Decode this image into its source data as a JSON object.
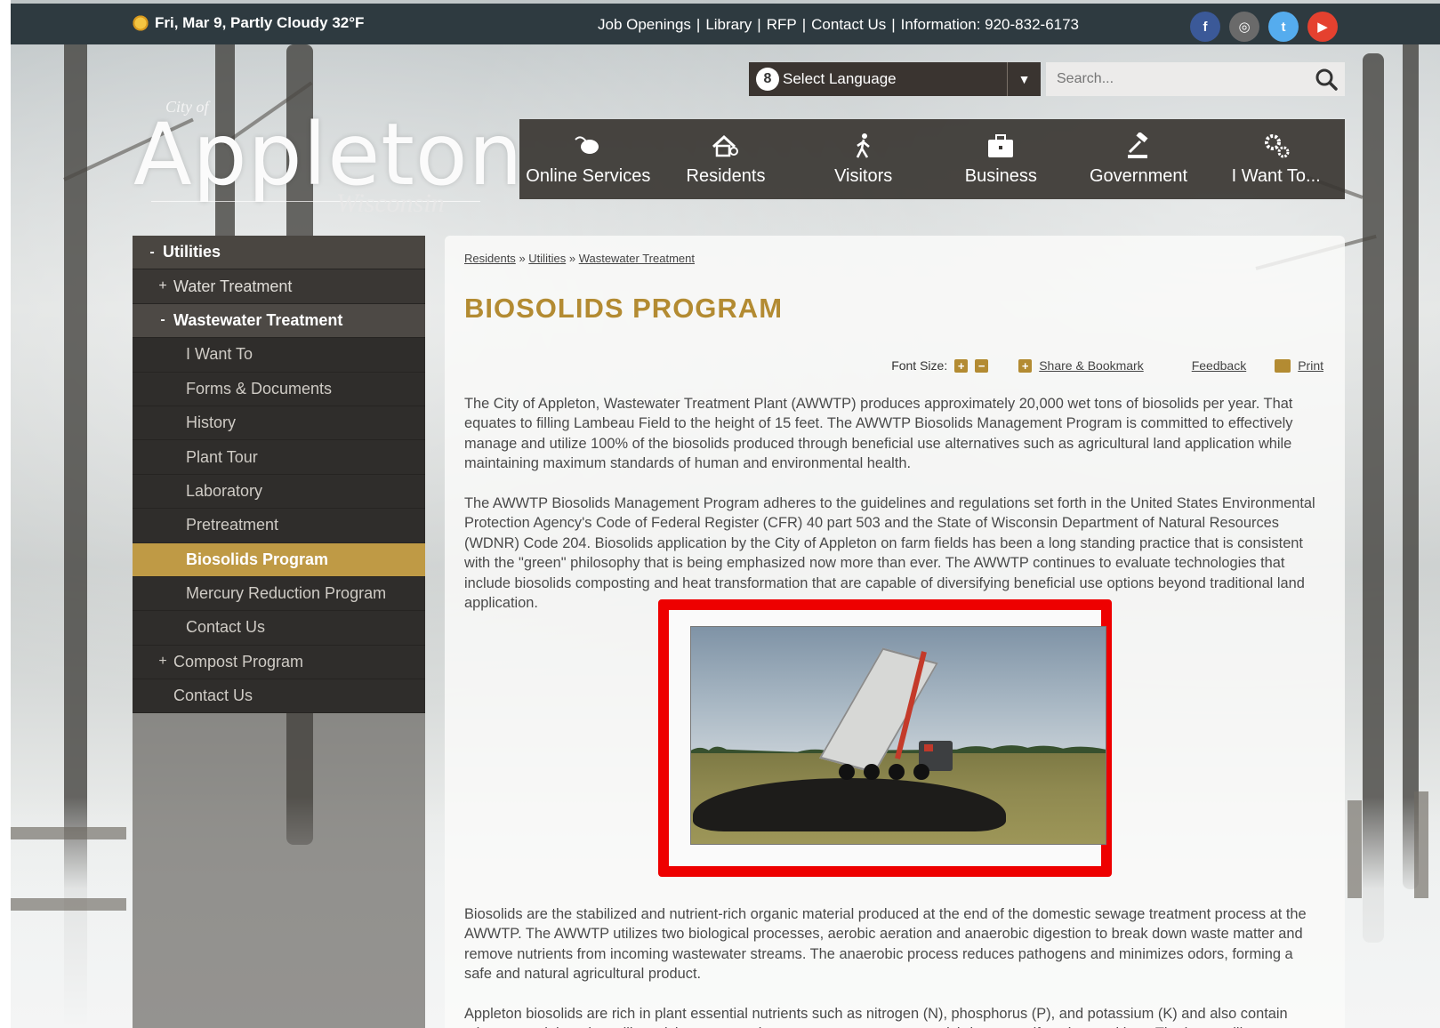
{
  "topbar": {
    "weather": "Fri, Mar 9, Partly Cloudy 32°F",
    "links": [
      "Job Openings",
      "Library",
      "RFP",
      "Contact Us"
    ],
    "info": "Information: 920-832-6173",
    "social": [
      {
        "name": "facebook-icon",
        "glyph": "f",
        "color": "#3b5998"
      },
      {
        "name": "instagram-icon",
        "glyph": "◎",
        "color": "#6a6a6a"
      },
      {
        "name": "twitter-icon",
        "glyph": "t",
        "color": "#55acee"
      },
      {
        "name": "youtube-icon",
        "glyph": "▶",
        "color": "#e5412f"
      }
    ]
  },
  "language": {
    "g": "8",
    "label": "Select Language",
    "caret": "▼"
  },
  "search": {
    "placeholder": "Search..."
  },
  "logo": {
    "city": "City of",
    "name": "Appleton",
    "state": "Wisconsin"
  },
  "mainnav": [
    {
      "label": "Online Services",
      "icon": "mouse-icon"
    },
    {
      "label": "Residents",
      "icon": "house-search-icon"
    },
    {
      "label": "Visitors",
      "icon": "walking-person-icon"
    },
    {
      "label": "Business",
      "icon": "briefcase-icon"
    },
    {
      "label": "Government",
      "icon": "gavel-icon"
    },
    {
      "label": "I Want To...",
      "icon": "gears-icon"
    }
  ],
  "sidebar": {
    "items": [
      {
        "label": "Utilities",
        "mark": "-",
        "level": "lvl0"
      },
      {
        "label": "Water Treatment",
        "mark": "+",
        "level": "lvl1"
      },
      {
        "label": "Wastewater Treatment",
        "mark": "-",
        "level": "lvl1 open"
      },
      {
        "label": "I Want To",
        "mark": "",
        "level": "lvl2"
      },
      {
        "label": "Forms & Documents",
        "mark": "",
        "level": "lvl2"
      },
      {
        "label": "History",
        "mark": "",
        "level": "lvl2"
      },
      {
        "label": "Plant Tour",
        "mark": "",
        "level": "lvl2"
      },
      {
        "label": "Laboratory",
        "mark": "",
        "level": "lvl2"
      },
      {
        "label": "Pretreatment",
        "mark": "",
        "level": "lvl2"
      },
      {
        "label": "Biosolids Program",
        "mark": "",
        "level": "lvl2 active"
      },
      {
        "label": "Mercury Reduction Program",
        "mark": "",
        "level": "lvl2"
      },
      {
        "label": "Contact Us",
        "mark": "",
        "level": "lvl2"
      },
      {
        "label": "Compost Program",
        "mark": "+",
        "level": "lvl1b"
      },
      {
        "label": "Contact Us",
        "mark": "",
        "level": "lvl1b"
      }
    ]
  },
  "breadcrumb": {
    "items": [
      "Residents",
      "Utilities",
      "Wastewater Treatment"
    ],
    "sep": "»"
  },
  "page": {
    "title": "BIOSOLIDS PROGRAM"
  },
  "tools": {
    "font_size": "Font Size:",
    "plus": "+",
    "minus": "−",
    "share_plus": "+",
    "share": "Share & Bookmark",
    "feedback": "Feedback",
    "print": "Print"
  },
  "paragraphs": {
    "p1": "The City of Appleton, Wastewater Treatment Plant (AWWTP) produces approximately 20,000 wet tons of biosolids per year. That equates to filling Lambeau Field to the height of 15 feet. The AWWTP Biosolids Management Program is committed to effectively manage and utilize 100% of the biosolids produced through beneficial use alternatives such as agricultural land application while maintaining maximum standards of human and environmental health.",
    "p2": "The AWWTP Biosolids Management Program adheres to the guidelines and regulations set forth in the United States Environmental Protection Agency's Code of Federal Register (CFR) 40 part 503 and the State of Wisconsin Department of Natural Resources (WDNR) Code 204. Biosolids application by the City of Appleton on farm fields has been a long standing practice that is consistent with the \"green\" philosophy that is being emphasized now more than ever. The AWWTP continues to evaluate technologies that include biosolids composting and heat transformation that are capable of diversifying beneficial use options beyond traditional land application.",
    "p3": "Biosolids are the stabilized and nutrient-rich organic material produced at the end of the domestic sewage treatment process at the AWWTP. The AWWTP utilizes two biological processes, aerobic aeration and anaerobic digestion to break down waste matter and remove nutrients from incoming wastewater streams. The anaerobic process reduces pathogens and minimizes odors, forming a safe and natural agricultural product.",
    "p4": "Appleton biosolids are rich in plant essential nutrients such as nitrogen (N), phosphorus (P), and potassium (K) and also contain other essential nutrients like calcium, magnesium, manganese, copper, molybdenum, sulfur, zinc, and iron. The humus-like"
  },
  "colors": {
    "accent": "#b38b32",
    "highlight": "#ee0000",
    "topbar": "#2e3a40"
  }
}
